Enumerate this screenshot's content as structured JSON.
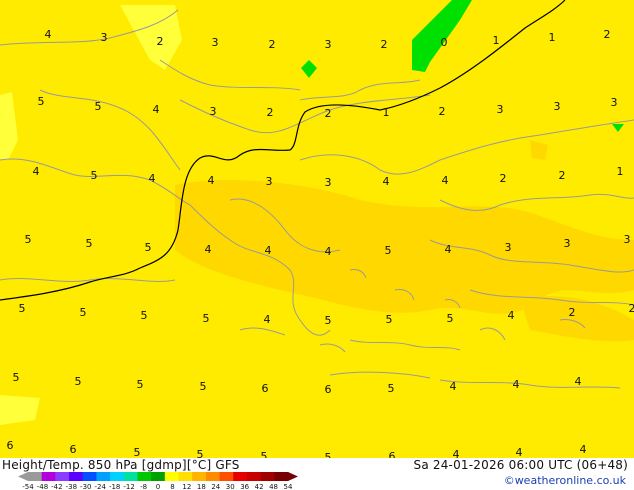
{
  "title": "Height/Temp. 850 hPa [gdmp][°C] GFS",
  "datetime": "Sa 24-01-2026 06:00 UTC (06+48)",
  "credit": "©weatheronline.co.uk",
  "colors": {
    "background": "#ffeb00",
    "warmer_zone": "#ffd800",
    "light_yellow": "#ffff3a",
    "green": "#00e000",
    "coastline": "#9a9a9a",
    "contour": "#000000",
    "credit": "#1a3fb5"
  },
  "legend": {
    "ticks": [
      "-54",
      "-48",
      "-42",
      "-38",
      "-30",
      "-24",
      "-18",
      "-12",
      "-8",
      "0",
      "8",
      "12",
      "18",
      "24",
      "30",
      "36",
      "42",
      "48",
      "54"
    ],
    "colors": [
      "#9a9a9a",
      "#b400dc",
      "#8c3cff",
      "#5a00ff",
      "#0050ff",
      "#00a0ff",
      "#00d2ff",
      "#00e0a0",
      "#00c800",
      "#00a000",
      "#ffff00",
      "#ffe000",
      "#ffb400",
      "#ff8c00",
      "#ff5000",
      "#e60000",
      "#c80000",
      "#a00000",
      "#780000"
    ]
  },
  "temperature_labels": [
    "4",
    "3",
    "2",
    "3",
    "2",
    "3",
    "2",
    "0",
    "1",
    "1",
    "2",
    "5",
    "5",
    "4",
    "3",
    "2",
    "2",
    "1",
    "2",
    "3",
    "3",
    "3",
    "4",
    "5",
    "4",
    "4",
    "3",
    "3",
    "4",
    "4",
    "2",
    "2",
    "1",
    "5",
    "5",
    "5",
    "4",
    "4",
    "4",
    "5",
    "4",
    "3",
    "3",
    "3",
    "5",
    "5",
    "5",
    "5",
    "4",
    "5",
    "5",
    "5",
    "4",
    "2",
    "2",
    "5",
    "5",
    "5",
    "5",
    "6",
    "6",
    "5",
    "4",
    "4",
    "4",
    "6",
    "6",
    "5",
    "5",
    "5",
    "5",
    "6",
    "4",
    "4",
    "4"
  ]
}
